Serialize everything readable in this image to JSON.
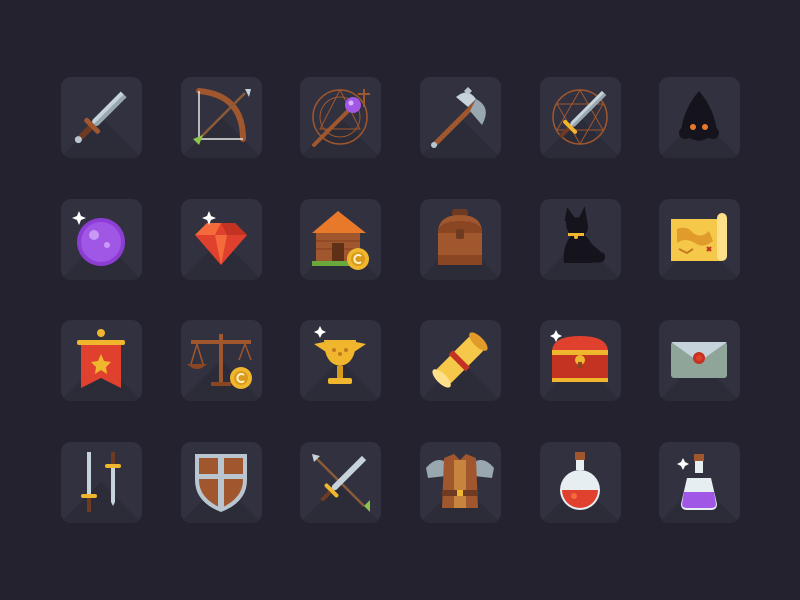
{
  "icons": [
    "sword-icon",
    "bow-and-arrow-icon",
    "magic-staff-icon",
    "battle-axe-icon",
    "enchanted-sword-icon",
    "shadow-creature-icon",
    "crystal-orb-icon",
    "ruby-gem-icon",
    "wooden-house-icon",
    "leather-backpack-icon",
    "black-cat-icon",
    "treasure-map-icon",
    "war-banner-icon",
    "balance-scale-icon",
    "golden-goblet-icon",
    "rolled-scroll-icon",
    "treasure-chest-icon",
    "sealed-letter-icon",
    "twin-swords-icon",
    "wooden-shield-icon",
    "crossed-sword-arrow-icon",
    "leather-armor-icon",
    "health-potion-icon",
    "mana-potion-icon"
  ],
  "colors": {
    "background": "#23222e",
    "tile": "#32313f",
    "gold": "#f0b62e",
    "steel": "#b9c6cf",
    "wood": "#a0572e",
    "red": "#e0412e",
    "purple": "#a157e6"
  }
}
